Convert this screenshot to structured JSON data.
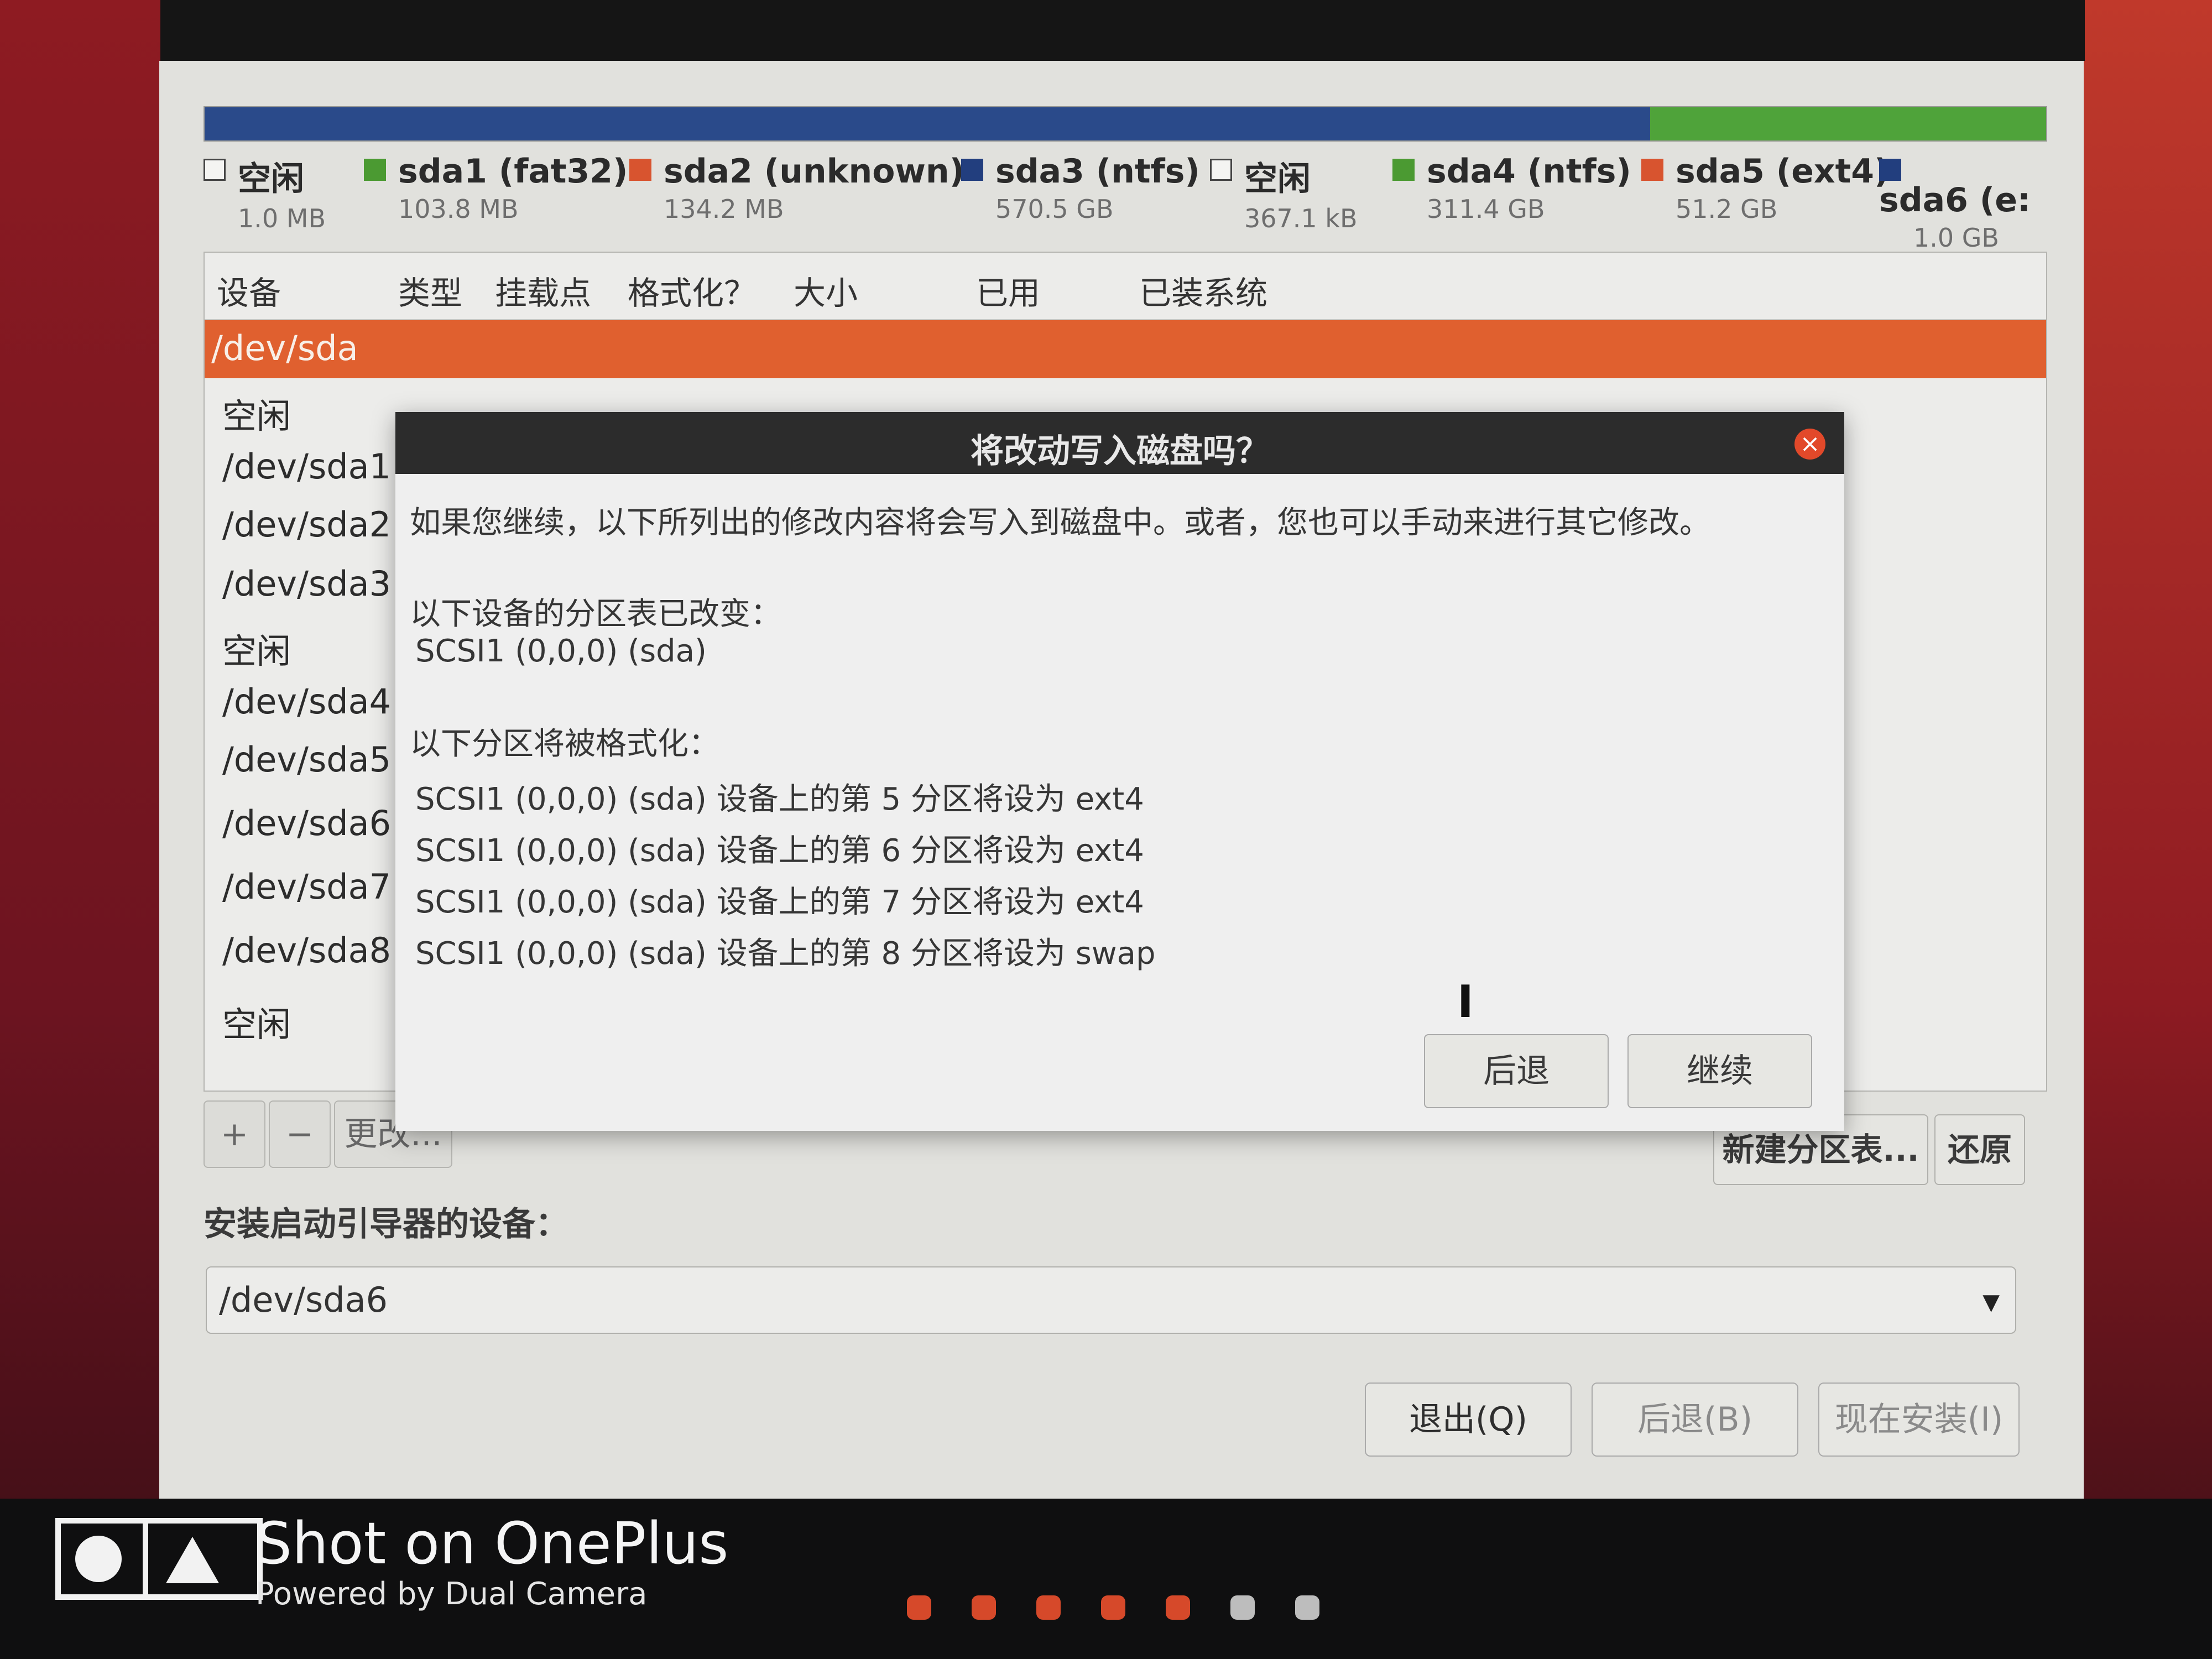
{
  "legend": [
    {
      "name": "空闲",
      "size": "1.0 MB",
      "color": "#f4f4f2",
      "outlined": true
    },
    {
      "name": "sda1 (fat32)",
      "size": "103.8 MB",
      "color": "#4b9a32"
    },
    {
      "name": "sda2 (unknown)",
      "size": "134.2 MB",
      "color": "#d8542f"
    },
    {
      "name": "sda3 (ntfs)",
      "size": "570.5 GB",
      "color": "#223e7e"
    },
    {
      "name": "空闲",
      "size": "367.1 kB",
      "color": "#f4f4f2",
      "outlined": true
    },
    {
      "name": "sda4 (ntfs)",
      "size": "311.4 GB",
      "color": "#4b9a32"
    },
    {
      "name": "sda5 (ext4)",
      "size": "51.2 GB",
      "color": "#d8542f"
    },
    {
      "name": "sda6 (e:",
      "size": "1.0 GB",
      "color": "#223e7e"
    }
  ],
  "partition_bar_colors": {
    "primary": "#2a4a8a",
    "secondary": "#4fa33a"
  },
  "table": {
    "headers": {
      "device": "设备",
      "type": "类型",
      "mount": "挂载点",
      "format": "格式化？",
      "size": "大小",
      "used": "已用",
      "installed": "已装系统"
    },
    "selected": "/dev/sda",
    "rows": [
      "空闲",
      "/dev/sda1",
      "/dev/sda2",
      "/dev/sda3",
      "空闲",
      "/dev/sda4",
      "/dev/sda5",
      "/dev/sda6",
      "/dev/sda7",
      "/dev/sda8",
      "空闲"
    ]
  },
  "tools": {
    "add": "+",
    "remove": "−",
    "change": "更改..."
  },
  "right_buttons": {
    "new_table": "新建分区表...",
    "revert": "还原"
  },
  "bootloader": {
    "label": "安装启动引导器的设备：",
    "value": "/dev/sda6"
  },
  "bottom_buttons": {
    "quit": "退出(Q)",
    "back": "后退(B)",
    "install": "现在安装(I)"
  },
  "dialog": {
    "title": "将改动写入磁盘吗？",
    "intro": "如果您继续，以下所列出的修改内容将会写入到磁盘中。或者，您也可以手动来进行其它修改。",
    "table_changed_heading": "以下设备的分区表已改变：",
    "table_changed_device": "SCSI1 (0,0,0) (sda)",
    "format_heading": "以下分区将被格式化：",
    "format_lines": [
      "SCSI1 (0,0,0) (sda) 设备上的第 5 分区将设为 ext4",
      "SCSI1 (0,0,0) (sda) 设备上的第 6 分区将设为 ext4",
      "SCSI1 (0,0,0) (sda) 设备上的第 7 分区将设为 ext4",
      "SCSI1 (0,0,0) (sda) 设备上的第 8 分区将设为 swap"
    ],
    "back_button": "后退",
    "continue_button": "继续"
  },
  "watermark": {
    "main": "Shot on OnePlus",
    "sub": "Powered by Dual Camera"
  },
  "page_dots": {
    "count": 7,
    "active_color": "#d6492a",
    "inactive_color": "#bdbdbd",
    "active_count": 5
  }
}
